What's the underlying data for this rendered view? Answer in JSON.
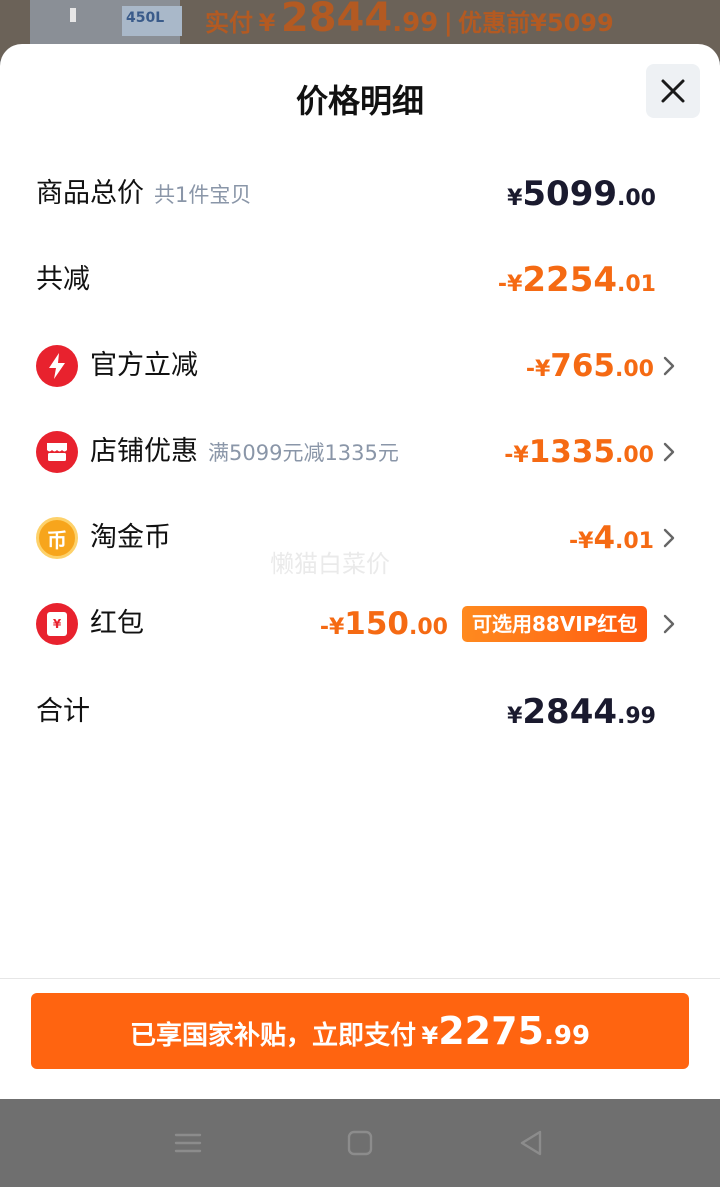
{
  "background_product": {
    "thumb_tag": "450L",
    "price_label": "实付",
    "price_currency": "¥",
    "price_int": "2844",
    "price_dec": ".99",
    "separator": "|",
    "original_label": "优惠前",
    "original_price": "¥5099"
  },
  "sheet": {
    "title": "价格明细",
    "close_icon": "close-icon"
  },
  "rows": {
    "subtotal": {
      "label": "商品总价",
      "sub": "共1件宝贝",
      "sign": "",
      "currency": "¥",
      "int": "5099",
      "dec": ".00"
    },
    "total_discount": {
      "label": "共减",
      "sign": "-",
      "currency": "¥",
      "int": "2254",
      "dec": ".01"
    },
    "official": {
      "label": "官方立减",
      "icon": "lightning-icon",
      "sign": "-",
      "currency": "¥",
      "int": "765",
      "dec": ".00"
    },
    "store": {
      "label": "店铺优惠",
      "sub": "满5099元减1335元",
      "icon": "store-icon",
      "sign": "-",
      "currency": "¥",
      "int": "1335",
      "dec": ".00"
    },
    "coins": {
      "label": "淘金币",
      "icon": "coin-icon",
      "coin_char": "币",
      "sign": "-",
      "currency": "¥",
      "int": "4",
      "dec": ".01"
    },
    "redpacket": {
      "label": "红包",
      "icon": "red-packet-icon",
      "packet_char": "¥",
      "sign": "-",
      "currency": "¥",
      "int": "150",
      "dec": ".00",
      "badge": "可选用88VIP红包"
    },
    "total": {
      "label": "合计",
      "currency": "¥",
      "int": "2844",
      "dec": ".99"
    }
  },
  "watermark": "懒猫白菜价",
  "pay_button": {
    "text": "已享国家补贴，立即支付",
    "currency": "¥",
    "int": "2275",
    "dec": ".99"
  },
  "colors": {
    "accent": "#ff6410",
    "discount": "#f56a13",
    "icon_red": "#e8222e",
    "coin": "#f7a51c"
  }
}
